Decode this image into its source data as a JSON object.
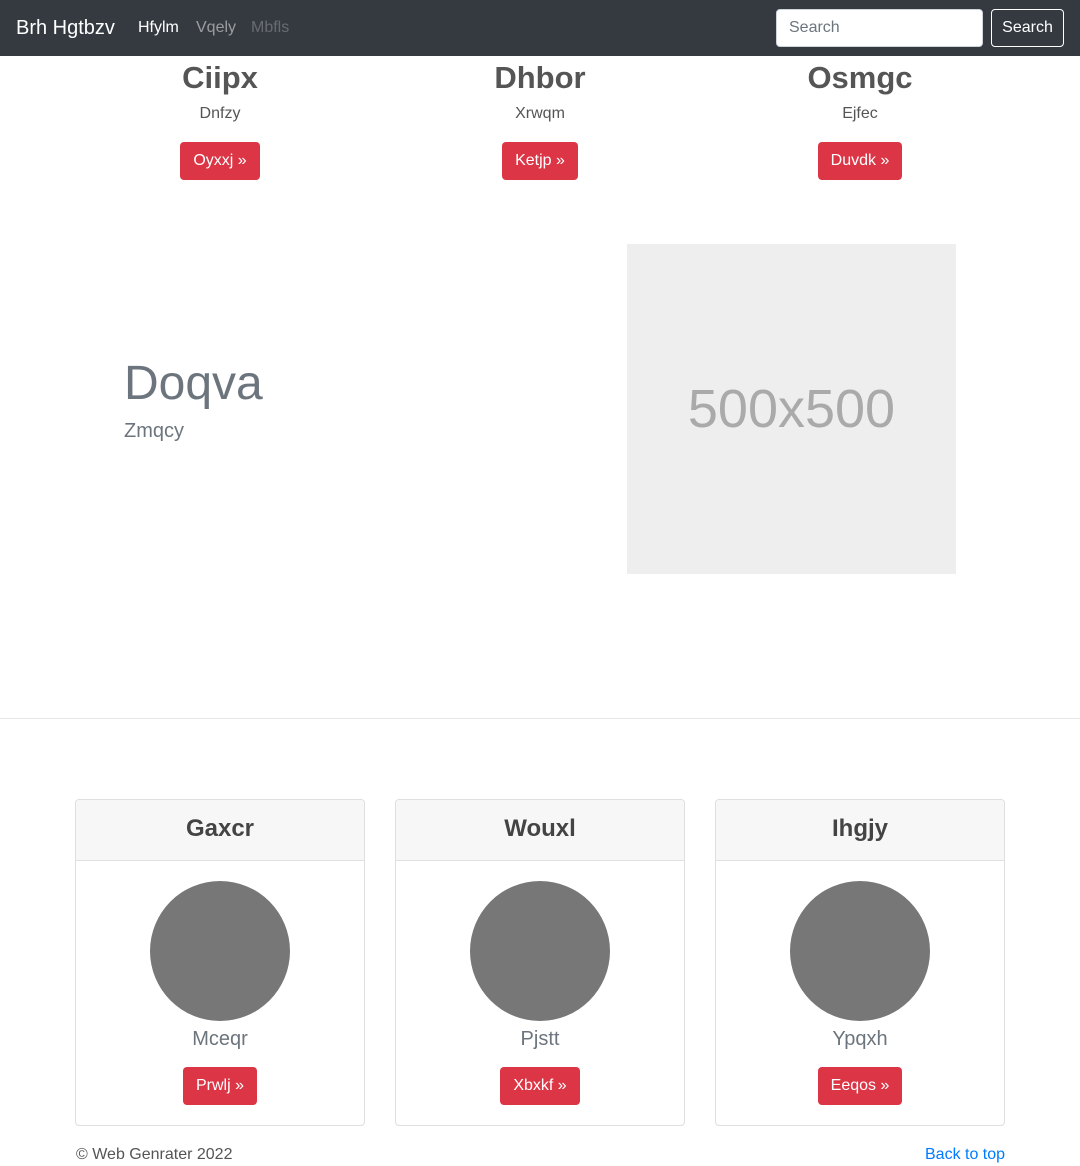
{
  "navbar": {
    "brand": "Brh Hgtbzv",
    "links": [
      {
        "label": "Hfylm",
        "state": "active"
      },
      {
        "label": "Vqely",
        "state": "normal"
      },
      {
        "label": "Mbfls",
        "state": "disabled"
      }
    ],
    "search": {
      "placeholder": "Search",
      "button_label": "Search"
    }
  },
  "columns": [
    {
      "heading": "Ciipx",
      "text": "Dnfzy",
      "button_label": "Oyxxj »"
    },
    {
      "heading": "Dhbor",
      "text": "Xrwqm",
      "button_label": "Ketjp »"
    },
    {
      "heading": "Osmgc",
      "text": "Ejfec",
      "button_label": "Duvdk »"
    }
  ],
  "feature": {
    "title": "Doqva",
    "subtitle": "Zmqcy",
    "image_label": "500x500"
  },
  "cards": [
    {
      "title": "Gaxcr",
      "name": "Mceqr",
      "button_label": "Prwlj »"
    },
    {
      "title": "Wouxl",
      "name": "Pjstt",
      "button_label": "Xbxkf »"
    },
    {
      "title": "Ihgjy",
      "name": "Ypqxh",
      "button_label": "Eeqos »"
    }
  ],
  "footer": {
    "copyright": "© Web Genrater 2022",
    "back_to_top": "Back to top"
  },
  "colors": {
    "navbar_bg": "#343a40",
    "button_red": "#dc3545",
    "link_blue": "#007bff",
    "avatar_gray": "#777777",
    "placeholder_bg": "#eeeeee"
  }
}
